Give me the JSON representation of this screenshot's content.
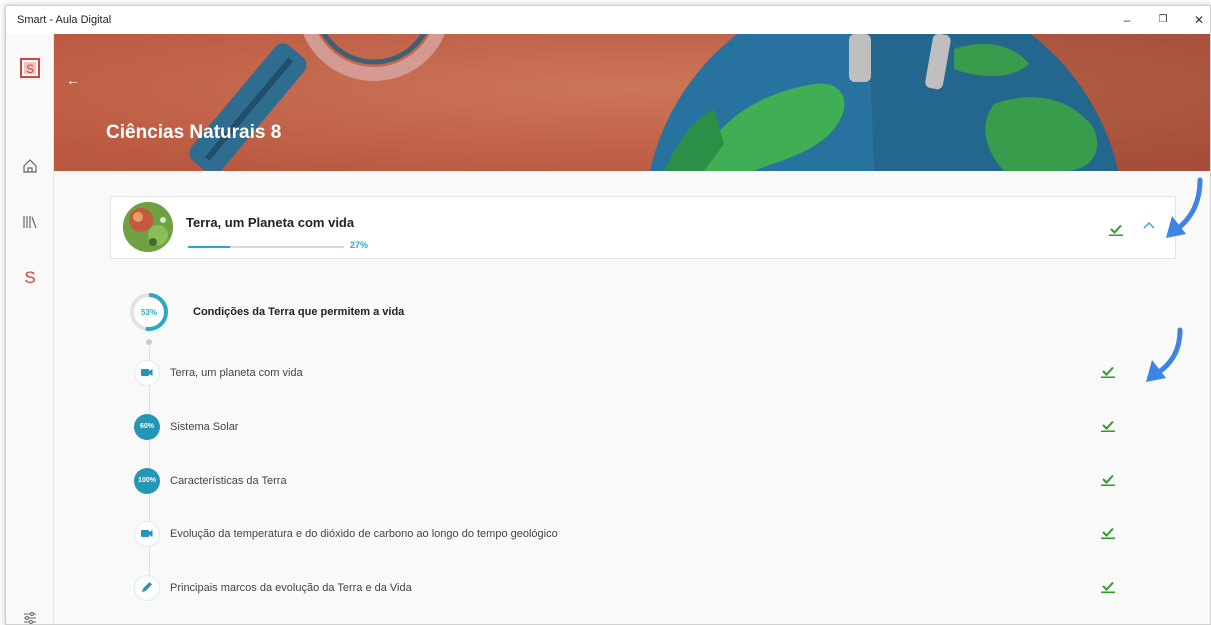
{
  "window": {
    "title": "Smart - Aula Digital",
    "minimize_glyph": "–",
    "restore_glyph": "❐",
    "close_glyph": "✕"
  },
  "sidebar": {
    "items": [
      {
        "name": "app-logo",
        "glyph": "S"
      },
      {
        "name": "home-icon"
      },
      {
        "name": "library-icon"
      },
      {
        "name": "smart-s-icon",
        "glyph": "S"
      },
      {
        "name": "settings-sliders-icon"
      }
    ]
  },
  "banner": {
    "back_glyph": "←",
    "title": "Ciências Naturais 8"
  },
  "unit_card": {
    "title": "Terra, um Planeta com vida",
    "progress": 0.27,
    "progress_label": "27%",
    "chevron_glyph": "︿"
  },
  "section": {
    "progress": 0.53,
    "progress_label": "53%",
    "title": "Condições da Terra que permitem a vida"
  },
  "items": [
    {
      "label": "Terra, um planeta com vida",
      "badge_type": "video-icon"
    },
    {
      "label": "Sistema Solar",
      "badge_type": "percent",
      "badge_label": "60%"
    },
    {
      "label": "Características da Terra",
      "badge_type": "percent",
      "badge_label": "100%"
    },
    {
      "label": "Evolução da temperatura e do dióxido de carbono ao longo do tempo geológico",
      "badge_type": "video-icon"
    },
    {
      "label": "Principais marcos da evolução da Terra e da Vida",
      "badge_type": "pencil-icon"
    }
  ],
  "colors": {
    "accent": "#2aa8c6",
    "check_green": "#2e9d2e",
    "banner": "#c86a4f",
    "smart_red": "#d9413a",
    "annotation_arrow": "#3f84e5"
  }
}
